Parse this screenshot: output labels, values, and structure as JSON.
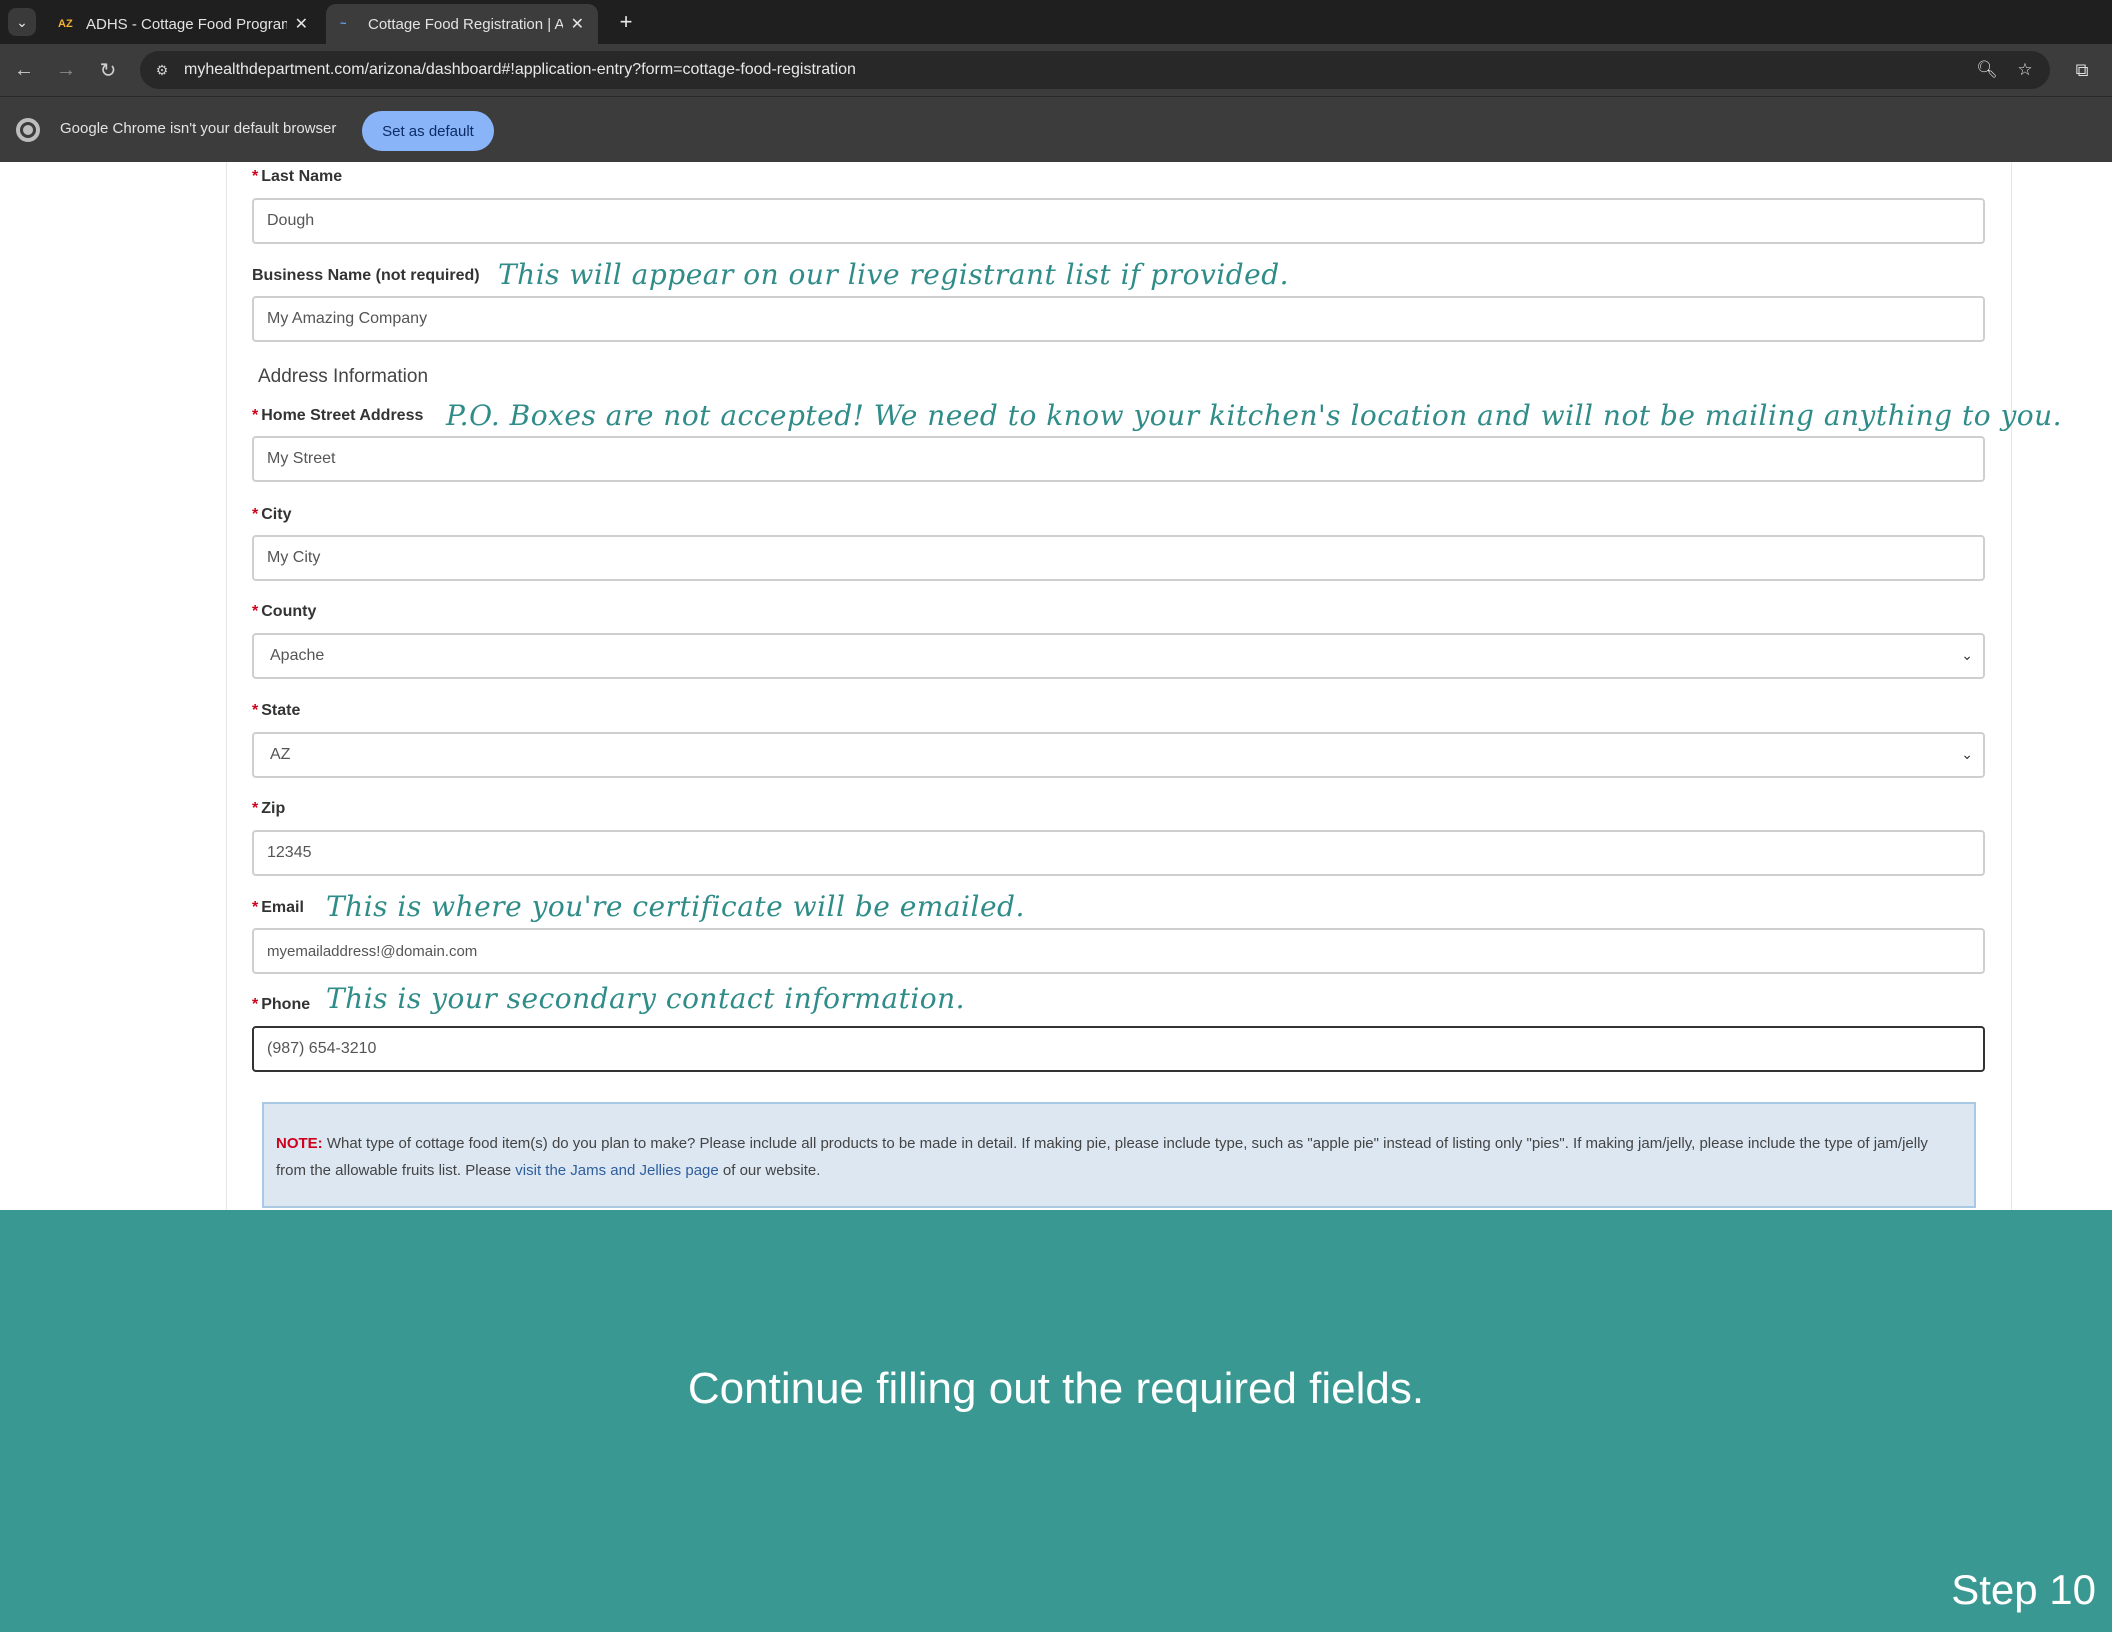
{
  "browser": {
    "tabs": [
      {
        "title": "ADHS - Cottage Food Program",
        "favicon": "az-logo-icon",
        "active": false
      },
      {
        "title": "Cottage Food Registration | Ari",
        "favicon": "myhealth-logo-icon",
        "active": true
      }
    ],
    "url": "myhealthdepartment.com/arizona/dashboard#!application-entry?form=cottage-food-registration",
    "infobar_text": "Google Chrome isn't your default browser",
    "infobar_button": "Set as default"
  },
  "form": {
    "last_name": {
      "label": "Last Name",
      "required": true,
      "value": "Dough"
    },
    "business_name": {
      "label": "Business Name (not required)",
      "value": "My Amazing Company",
      "annotation": "This will appear on our live registrant list if provided."
    },
    "address_section_title": "Address Information",
    "street": {
      "label": "Home Street Address",
      "required": true,
      "value": "My Street",
      "annotation": "P.O. Boxes are not accepted! We need to know your kitchen's location and will not be mailing anything to you."
    },
    "city": {
      "label": "City",
      "required": true,
      "value": "My City"
    },
    "county": {
      "label": "County",
      "required": true,
      "value": "Apache"
    },
    "state": {
      "label": "State",
      "required": true,
      "value": "AZ"
    },
    "zip": {
      "label": "Zip",
      "required": true,
      "value": "12345"
    },
    "email": {
      "label": "Email",
      "required": true,
      "value": "myemailaddress!@domain.com",
      "annotation": "This is where you're certificate will be emailed."
    },
    "phone": {
      "label": "Phone",
      "required": true,
      "value": "(987) 654-3210",
      "annotation": "This is your secondary contact information."
    },
    "required_marker": "*"
  },
  "note": {
    "label": "NOTE:",
    "text_before_link": "What type of cottage food item(s) do you plan to make? Please include all products to be made in detail. If making pie, please include type, such as \"apple pie\" instead of listing only \"pies\". If making jam/jelly, please include the type of jam/jelly from the allowable fruits list. Please",
    "link_text": "visit the Jams and Jellies page",
    "text_after_link": "of our website."
  },
  "banner": {
    "instruction": "Continue filling out the required fields.",
    "step": "Step 10"
  },
  "colors": {
    "banner_bg": "#399891",
    "annotation_text": "#2f8c88",
    "required_asterisk": "#d0021b",
    "note_bg": "#dce7f2"
  }
}
